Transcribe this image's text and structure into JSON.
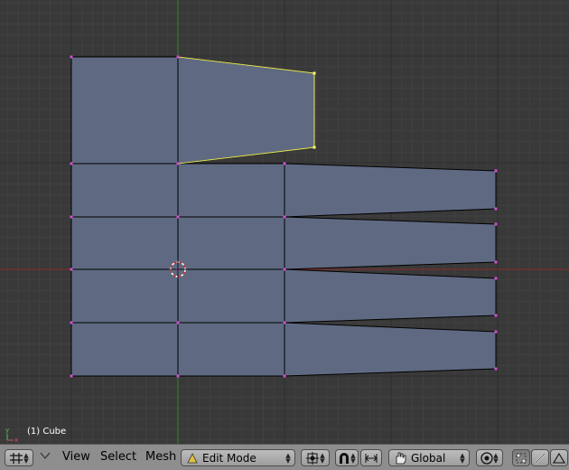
{
  "viewport": {
    "object_label": "(1) Cube",
    "axis_labels": {
      "x": "x",
      "y": "y"
    }
  },
  "header": {
    "menus": [
      "View",
      "Select",
      "Mesh"
    ],
    "mode_selector": {
      "value": "Edit Mode"
    },
    "orientation_selector": {
      "value": "Global"
    }
  },
  "colors": {
    "background": "#393939",
    "grid_minor": "#414141",
    "grid_major": "#2e2e2e",
    "x_axis": "#8c2a2a",
    "y_axis": "#2a8a2a",
    "face": "#5f6a82",
    "edge": "#000000",
    "selected_edge": "#e8e85a",
    "vertex": "#d54fd5",
    "selected_vertex": "#ffff70",
    "header_bg": "#8e8e8e"
  },
  "icons": [
    "grid-icon",
    "dropdown-arrow-icon",
    "mode-icon",
    "pivot-icon",
    "magnet-icon",
    "snap-icon",
    "hand-icon",
    "proportional-icon",
    "vertex-select-icon",
    "edge-select-icon",
    "face-select-icon"
  ]
}
